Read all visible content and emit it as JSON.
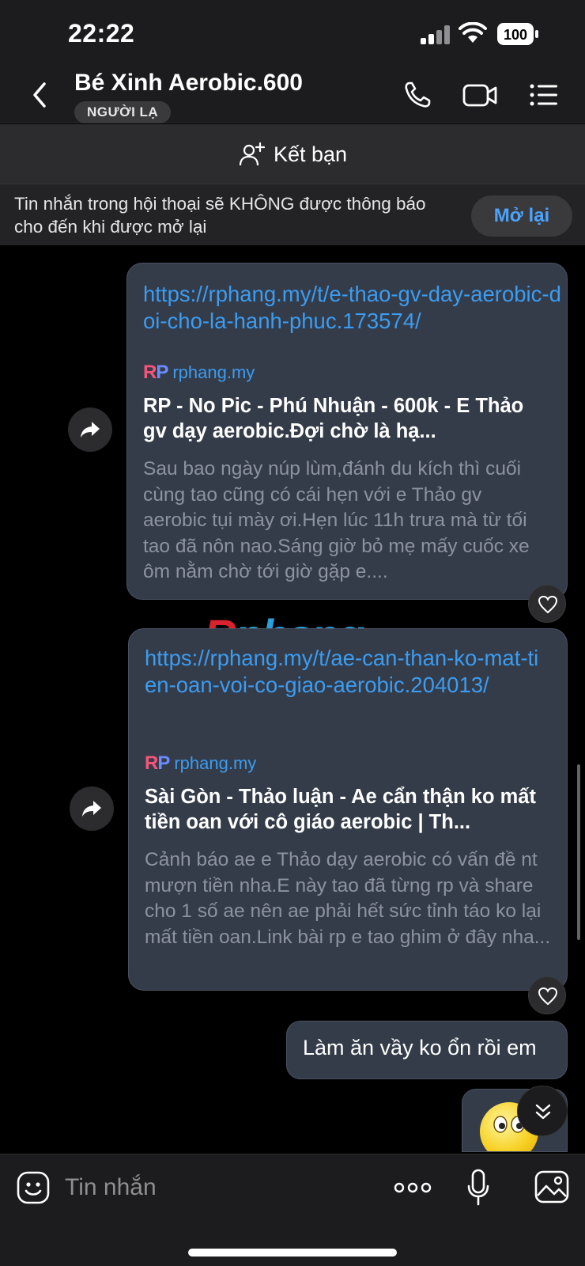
{
  "status_bar": {
    "time": "22:22",
    "battery": "100"
  },
  "header": {
    "title": "Bé Xinh Aerobic.600",
    "badge": "NGƯỜI LẠ",
    "icons": [
      "back-icon",
      "phone-icon",
      "video-icon",
      "menu-icon"
    ]
  },
  "add_friend": {
    "label": "Kết bạn",
    "icon": "add-person-icon"
  },
  "notification": {
    "text": "Tin nhắn trong hội thoại sẽ KHÔNG được thông báo cho đến khi được mở lại",
    "button": "Mở lại"
  },
  "messages": [
    {
      "type": "link",
      "url": "https://rphang.my/t/e-thao-gv-day-aerobic-doi-cho-la-hanh-phuc.173574/",
      "site_logo": "RP",
      "site": "rphang.my",
      "headline": "RP - No Pic - Phú Nhuận - 600k - E Thảo gv dạy aerobic.Đợi chờ là hạ...",
      "description": "Sau bao ngày núp lùm,đánh du kích thì cuối cùng tao cũng có cái hẹn với e Thảo gv aerobic tụi mày ơi.Hẹn lúc 11h trưa mà từ tối tao đã nôn nao.Sáng giờ bỏ mẹ mấy cuốc xe ôm nằm chờ tới giờ gặp e...."
    },
    {
      "type": "link",
      "url": "https://rphang.my/t/ae-can-than-ko-mat-tien-oan-voi-co-giao-aerobic.204013/",
      "site_logo": "RP",
      "site": "rphang.my",
      "headline": "Sài Gòn - Thảo luận - Ae cẩn thận ko mất tiền oan với cô giáo aerobic | Th...",
      "description": "Cảnh báo ae e Thảo dạy aerobic có vấn đề nt mượn tiền nha.E này tao đã từng rp và share cho 1 số ae nên ae phải hết sức tỉnh táo ko lại mất tiền oan.Link bài rp e tao ghim ở  đây nha..."
    },
    {
      "type": "text",
      "text": "Làm ăn vầy ko ổn rồi em"
    },
    {
      "type": "sticker",
      "sticker": "smiley-sticker"
    }
  ],
  "watermark": {
    "part1": "R",
    "part2": "phang"
  },
  "composer": {
    "placeholder": "Tin nhắn"
  },
  "colors": {
    "link": "#3c9cf0",
    "bubble": "#343c4a",
    "background": "#000000",
    "accent": "#4aa3ff"
  }
}
